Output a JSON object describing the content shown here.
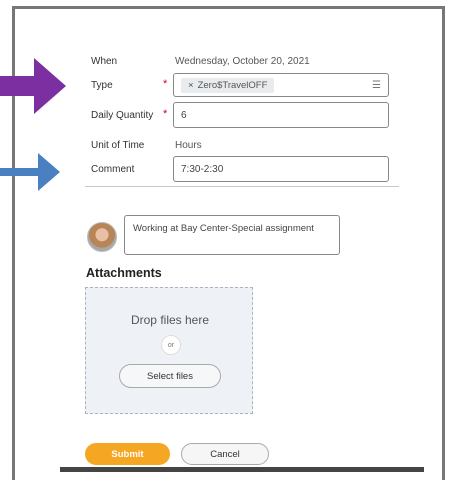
{
  "form": {
    "when_label": "When",
    "when_value": "Wednesday, October 20, 2021",
    "type_label": "Type",
    "type_required": "*",
    "type_value": "Zero$TravelOFF",
    "type_remove_glyph": "×",
    "type_list_glyph": "☰",
    "daily_quantity_label": "Daily Quantity",
    "daily_quantity_required": "*",
    "daily_quantity_value": "6",
    "unit_of_time_label": "Unit of Time",
    "unit_of_time_value": "Hours",
    "comment_label": "Comment",
    "comment_value": "7:30-2:30"
  },
  "activity": {
    "comment_text": "Working at Bay Center-Special assignment"
  },
  "attachments": {
    "title": "Attachments",
    "drop_text": "Drop files here",
    "or_text": "or",
    "select_label": "Select files"
  },
  "actions": {
    "submit_label": "Submit",
    "cancel_label": "Cancel"
  },
  "colors": {
    "type_arrow": "#7b2fa0",
    "comment_arrow": "#4a7fc1",
    "submit": "#f5a623",
    "required": "#d0021b"
  },
  "icons": {
    "type_arrow": "arrow-right-icon",
    "comment_arrow": "arrow-right-icon",
    "list": "list-icon",
    "remove": "close-icon"
  }
}
